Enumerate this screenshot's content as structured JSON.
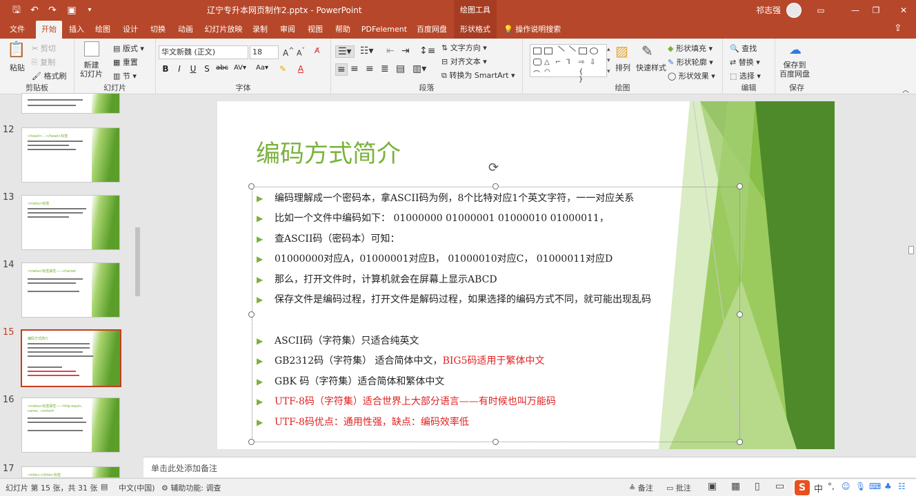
{
  "titlebar": {
    "doc_title": "辽宁专升本网页制作2.pptx  -  PowerPoint",
    "context_tools": "绘图工具",
    "user": "祁志强",
    "icons": [
      "save-icon",
      "undo-icon",
      "redo-icon",
      "present-icon",
      "customize-icon"
    ]
  },
  "tabs": [
    "文件",
    "开始",
    "插入",
    "绘图",
    "设计",
    "切换",
    "动画",
    "幻灯片放映",
    "录制",
    "审阅",
    "视图",
    "帮助",
    "PDFelement",
    "百度网盘",
    "形状格式"
  ],
  "active_tab": "开始",
  "tell_me": "操作说明搜索",
  "ribbon": {
    "clipboard": {
      "label": "剪贴板",
      "paste": "粘贴",
      "cut": "剪切",
      "copy": "复制",
      "format_painter": "格式刷"
    },
    "slides": {
      "label": "幻灯片",
      "new_slide": "新建\n幻灯片",
      "layout": "版式",
      "reset": "重置",
      "section": "节"
    },
    "font": {
      "label": "字体",
      "font_name": "华文新魏 (正文)",
      "font_size": "18"
    },
    "paragraph": {
      "label": "段落",
      "text_direction": "文字方向",
      "align_text": "对齐文本",
      "smartart": "转换为 SmartArt"
    },
    "drawing": {
      "label": "绘图",
      "arrange": "排列",
      "quick_styles": "快速样式",
      "shape_fill": "形状填充",
      "shape_outline": "形状轮廓",
      "shape_effects": "形状效果"
    },
    "editing": {
      "label": "编辑",
      "find": "查找",
      "replace": "替换",
      "select": "选择"
    },
    "save": {
      "label": "保存",
      "save_to_baidu": "保存到\n百度网盘"
    }
  },
  "thumbnails": [
    {
      "num": "12",
      "title": "<head>…</head>标签"
    },
    {
      "num": "13",
      "title": "<meta>标签"
    },
    {
      "num": "14",
      "title": "<meta>标签属性——charset"
    },
    {
      "num": "15",
      "title": "编码方式简介"
    },
    {
      "num": "16",
      "title": "<meta>标签属性——http-equiv、name、content"
    },
    {
      "num": "17",
      "title": "<title></title>标签"
    }
  ],
  "active_slide": "15",
  "slide": {
    "title": "编码方式简介",
    "bullets": [
      {
        "text": "编码理解成一个密码本，拿ASCII码为例，8个比特对应1个英文字符，一一对应关系",
        "red": ""
      },
      {
        "text": "比如一个文件中编码如下： 01000000 01000001 01000010 01000011，",
        "red": ""
      },
      {
        "text": "查ASCII码（密码本）可知：",
        "red": ""
      },
      {
        "text": "01000000对应A，01000001对应B， 01000010对应C， 01000011对应D",
        "red": ""
      },
      {
        "text": "那么，打开文件时，计算机就会在屏幕上显示ABCD",
        "red": ""
      },
      {
        "text": "保存文件是编码过程，打开文件是解码过程，如果选择的编码方式不同，就可能出现乱码",
        "red": ""
      },
      {
        "text": "ASCII码（字符集）只适合纯英文",
        "red": ""
      },
      {
        "text": "GB2312码（字符集） 适合简体中文，",
        "red": "BIG5码适用于繁体中文"
      },
      {
        "text": "GBK 码（字符集）适合简体和繁体中文",
        "red": ""
      },
      {
        "text": "",
        "red": "UTF-8码（字符集）适合世界上大部分语言——有时候也叫万能码"
      },
      {
        "text": "",
        "red": "UTF-8码优点：通用性强，缺点：编码效率低"
      }
    ]
  },
  "notes_placeholder": "单击此处添加备注",
  "status": {
    "slide_info": "幻灯片 第 15 张，共 31 张",
    "language": "中文(中国)",
    "accessibility": "辅助功能: 调查",
    "notes": "备注",
    "comments": "批注"
  },
  "colors": {
    "accent": "#b7472a",
    "slide_green": "#7ab23c",
    "red_text": "#e02020"
  }
}
